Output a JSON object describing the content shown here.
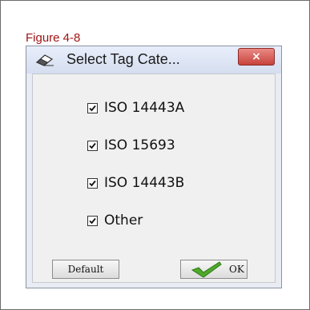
{
  "figure_caption": "Figure 4-8",
  "dialog": {
    "title": "Select Tag Cate...",
    "close_label": "×",
    "title_icon": "eraser-icon"
  },
  "options": [
    {
      "label": "ISO 14443A",
      "checked": true
    },
    {
      "label": "ISO 15693",
      "checked": true
    },
    {
      "label": "ISO 14443B",
      "checked": true
    },
    {
      "label": "Other",
      "checked": true
    }
  ],
  "buttons": {
    "default_label": "Default",
    "ok_label": "OK",
    "ok_icon": "checkmark-icon"
  },
  "colors": {
    "caption": "#a01414",
    "close_button": "#c8423c",
    "ok_check": "#4fa82a"
  }
}
